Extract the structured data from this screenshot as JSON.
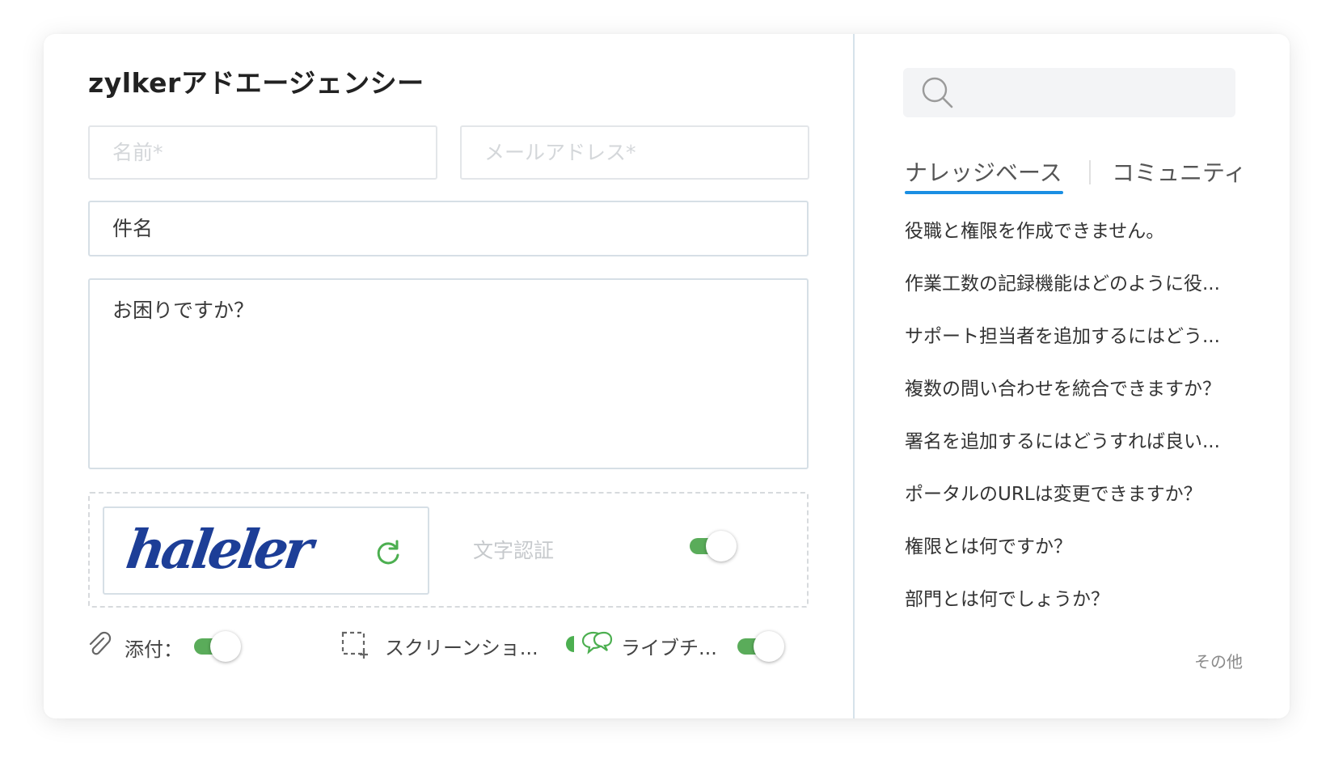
{
  "form": {
    "title": "zylkerアドエージェンシー",
    "name_placeholder": "名前*",
    "email_placeholder": "メールアドレス*",
    "subject_placeholder": "件名",
    "message_placeholder": "お困りですか？",
    "captcha_text": "haleler",
    "captcha_label": "文字認証",
    "captcha_toggle_on": true,
    "attach_label": "添付：",
    "attach_toggle_on": true,
    "screenshot_label": "スクリーンショ...",
    "chat_label": "ライブチ...",
    "chat_toggle_on": true
  },
  "sidebar": {
    "search_placeholder": "",
    "tabs": [
      {
        "label": "ナレッジベース",
        "active": true
      },
      {
        "label": "コミュニティ",
        "active": false
      }
    ],
    "articles": [
      "役職と権限を作成できません。",
      "作業工数の記録機能はどのように役...",
      "サポート担当者を追加するにはどう...",
      "複数の問い合わせを統合できますか？",
      "署名を追加するにはどうすれば良い...",
      "ポータルのURLは変更できますか？",
      "権限とは何ですか？",
      "部門とは何でしょうか？"
    ],
    "more_label": "その他"
  },
  "colors": {
    "accent": "#1a8fe3",
    "toggle_on": "#5aac5a",
    "captcha_text": "#1d3e97",
    "divider": "#d6e2ea"
  },
  "icons": [
    "refresh-icon",
    "paperclip-icon",
    "screenshot-icon",
    "chat-icon",
    "search-icon"
  ]
}
